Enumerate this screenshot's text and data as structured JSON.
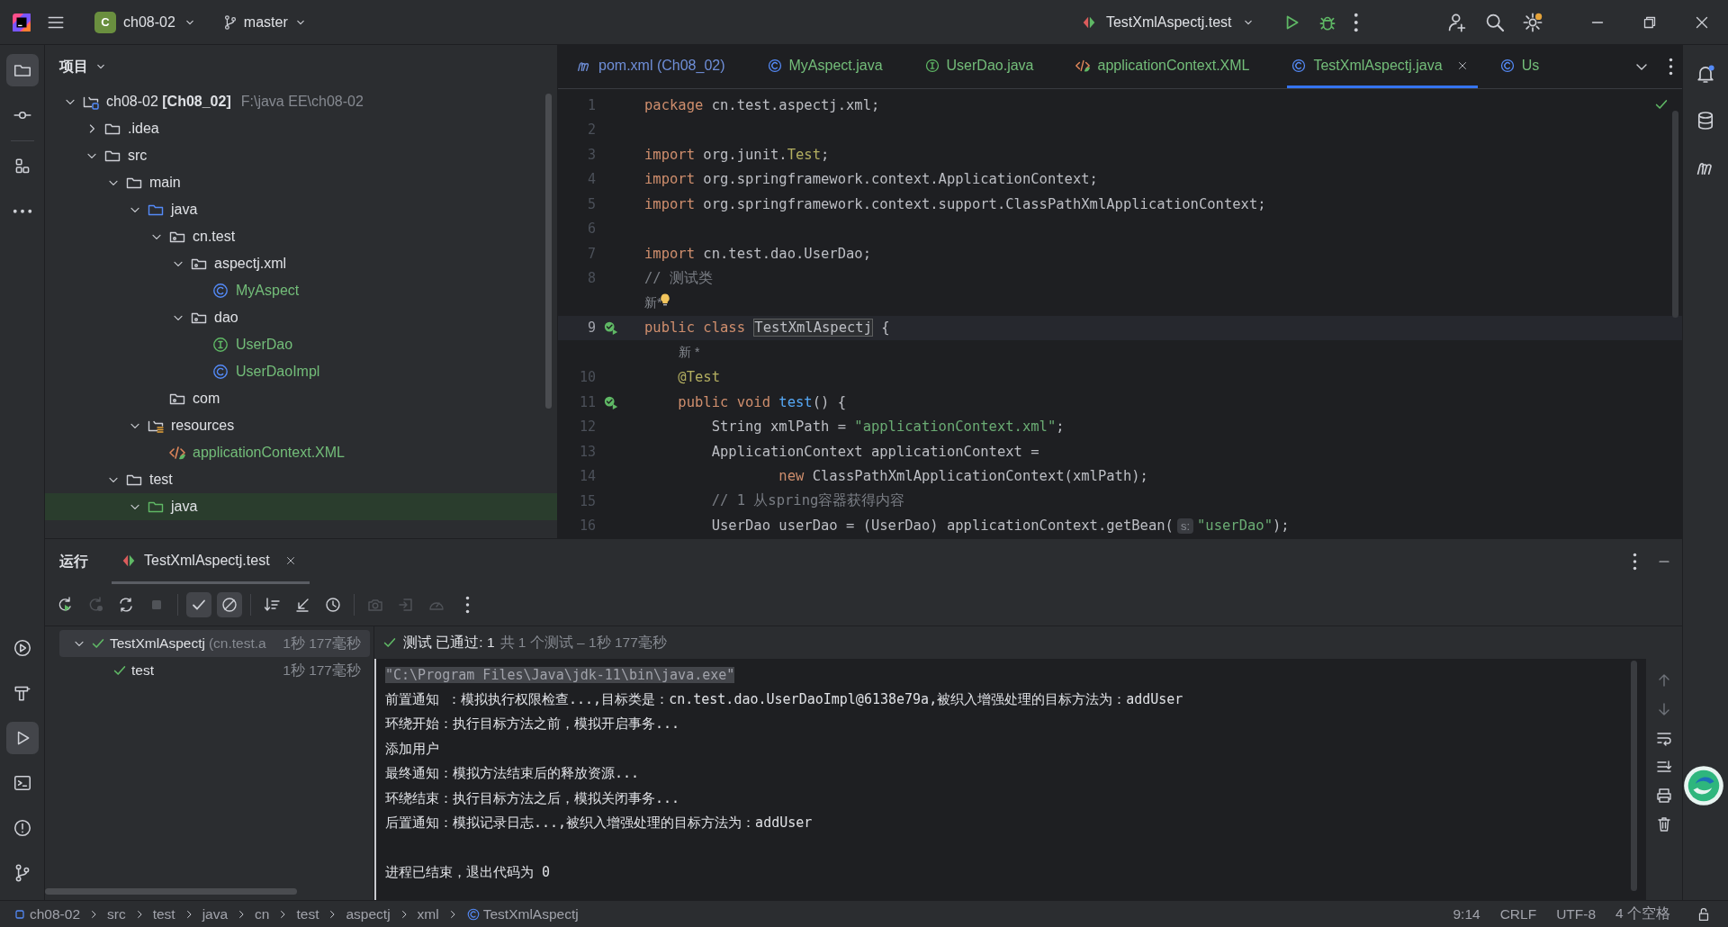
{
  "title_bar": {
    "project_badge": "C",
    "project": "ch08-02",
    "branch": "master",
    "run_config": "TestXmlAspectj.test"
  },
  "left_strip": {
    "top": [
      {
        "kind": "folder",
        "selected": true
      },
      {
        "kind": "commit",
        "selected": false
      },
      {
        "kind": "structure",
        "selected": false
      },
      {
        "kind": "more",
        "selected": false
      }
    ],
    "bottom": [
      {
        "kind": "services",
        "selected": false
      },
      {
        "kind": "build",
        "selected": false
      },
      {
        "kind": "run",
        "selected": true
      },
      {
        "kind": "terminal",
        "selected": false
      },
      {
        "kind": "problems",
        "selected": false
      },
      {
        "kind": "git",
        "selected": false
      }
    ]
  },
  "right_strip": [
    {
      "kind": "bell"
    },
    {
      "kind": "database"
    },
    {
      "kind": "maven"
    }
  ],
  "project_panel": {
    "title": "项目",
    "tree": [
      {
        "label": "ch08-02 **[Ch08_02]**",
        "path": "F:\\java EE\\ch08-02",
        "kind": "module",
        "expanded": true,
        "selected": false,
        "children": [
          {
            "label": ".idea",
            "kind": "folder",
            "expanded": false,
            "selected": false
          },
          {
            "label": "src",
            "kind": "folder",
            "expanded": true,
            "selected": false,
            "children": [
              {
                "label": "main",
                "kind": "folder",
                "expanded": true,
                "selected": false,
                "children": [
                  {
                    "label": "java",
                    "kind": "source",
                    "expanded": true,
                    "selected": false,
                    "children": [
                      {
                        "label": "cn.test",
                        "kind": "package",
                        "expanded": true,
                        "selected": false,
                        "children": [
                          {
                            "label": "aspectj.xml",
                            "kind": "package",
                            "expanded": true,
                            "selected": false,
                            "children": [
                              {
                                "label": "MyAspect",
                                "kind": "class",
                                "color": "#73bd79",
                                "selected": false
                              }
                            ]
                          },
                          {
                            "label": "dao",
                            "kind": "package",
                            "expanded": true,
                            "selected": false,
                            "children": [
                              {
                                "label": "UserDao",
                                "kind": "interface",
                                "color": "#73bd79",
                                "selected": false
                              },
                              {
                                "label": "UserDaoImpl",
                                "kind": "class",
                                "color": "#73bd79",
                                "selected": false
                              }
                            ]
                          }
                        ]
                      },
                      {
                        "label": "com",
                        "kind": "package",
                        "selected": false
                      }
                    ]
                  },
                  {
                    "label": "resources",
                    "kind": "resources",
                    "expanded": true,
                    "selected": false,
                    "children": [
                      {
                        "label": "applicationContext.XML",
                        "kind": "xml",
                        "color": "#73bd79",
                        "selected": false
                      }
                    ]
                  }
                ]
              },
              {
                "label": "test",
                "kind": "folder",
                "expanded": true,
                "selected": false,
                "children": [
                  {
                    "label": "java",
                    "kind": "testsource",
                    "expanded": true,
                    "selected": true
                  }
                ]
              }
            ]
          }
        ]
      }
    ]
  },
  "editor_tabs": [
    {
      "label": "pom.xml (Ch08_02)",
      "kind": "maven",
      "color": "#6f8fd9",
      "selected": false,
      "closable": false
    },
    {
      "label": "MyAspect.java",
      "kind": "class",
      "color": "#73bd79",
      "selected": false,
      "closable": false
    },
    {
      "label": "UserDao.java",
      "kind": "interface",
      "color": "#73bd79",
      "selected": false,
      "closable": false
    },
    {
      "label": "applicationContext.XML",
      "kind": "xml",
      "color": "#73bd79",
      "selected": false,
      "closable": false
    },
    {
      "label": "TestXmlAspectj.java",
      "kind": "class",
      "color": "#73bd79",
      "selected": true,
      "closable": true
    },
    {
      "label": "Us",
      "kind": "class",
      "color": "#73bd79",
      "selected": false,
      "closable": false
    }
  ],
  "editor": {
    "lines": [
      {
        "kind": "code",
        "number": "1",
        "current": false,
        "run_marker": false,
        "tokens": [
          {
            "kind": "kw",
            "text": "package"
          },
          {
            "kind": "plain",
            "text": " cn.test.aspectj.xml;"
          }
        ]
      },
      {
        "kind": "code",
        "number": "2",
        "current": false,
        "run_marker": false
      },
      {
        "kind": "code",
        "number": "3",
        "current": false,
        "run_marker": false,
        "tokens": [
          {
            "kind": "kw",
            "text": "import"
          },
          {
            "kind": "plain",
            "text": " org.junit."
          },
          {
            "kind": "ann",
            "text": "Test"
          },
          {
            "kind": "plain",
            "text": ";"
          }
        ]
      },
      {
        "kind": "code",
        "number": "4",
        "current": false,
        "run_marker": false,
        "tokens": [
          {
            "kind": "kw",
            "text": "import"
          },
          {
            "kind": "plain",
            "text": " org.springframework.context.ApplicationContext;"
          }
        ]
      },
      {
        "kind": "code",
        "number": "5",
        "current": false,
        "run_marker": false,
        "tokens": [
          {
            "kind": "kw",
            "text": "import"
          },
          {
            "kind": "plain",
            "text": " org.springframework.context.support.ClassPathXmlApplicationContext;"
          }
        ]
      },
      {
        "kind": "code",
        "number": "6",
        "current": false,
        "run_marker": false
      },
      {
        "kind": "code",
        "number": "7",
        "current": false,
        "run_marker": false,
        "tokens": [
          {
            "kind": "kw",
            "text": "import"
          },
          {
            "kind": "plain",
            "text": " cn.test.dao.UserDao;"
          }
        ]
      },
      {
        "kind": "code",
        "number": "8",
        "current": false,
        "run_marker": false,
        "tokens": [
          {
            "kind": "cmt",
            "text": "// 测试类"
          }
        ]
      },
      {
        "kind": "hint",
        "text": "新*",
        "bulb": true,
        "indent": false
      },
      {
        "kind": "code",
        "number": "9",
        "current": true,
        "run_marker": true,
        "tokens": [
          {
            "kind": "kw",
            "text": "public class "
          },
          {
            "kind": "ident",
            "text": "TestXmlAspectj"
          },
          {
            "kind": "plain",
            "text": " {"
          }
        ]
      },
      {
        "kind": "hint",
        "text": "新 *",
        "bulb": false,
        "indent": true
      },
      {
        "kind": "code",
        "number": "10",
        "current": false,
        "run_marker": false,
        "tokens": [
          {
            "kind": "ann",
            "text": "    @Test"
          }
        ]
      },
      {
        "kind": "code",
        "number": "11",
        "current": false,
        "run_marker": true,
        "tokens": [
          {
            "kind": "kw",
            "text": "    public void "
          },
          {
            "kind": "fn",
            "text": "test"
          },
          {
            "kind": "plain",
            "text": "() {"
          }
        ]
      },
      {
        "kind": "code",
        "number": "12",
        "current": false,
        "run_marker": false,
        "tokens": [
          {
            "kind": "plain",
            "text": "        String xmlPath = "
          },
          {
            "kind": "str",
            "text": "\"applicationContext.xml\""
          },
          {
            "kind": "plain",
            "text": ";"
          }
        ]
      },
      {
        "kind": "code",
        "number": "13",
        "current": false,
        "run_marker": false,
        "tokens": [
          {
            "kind": "plain",
            "text": "        ApplicationContext applicationContext ="
          }
        ]
      },
      {
        "kind": "code",
        "number": "14",
        "current": false,
        "run_marker": false,
        "tokens": [
          {
            "kind": "kw",
            "text": "                new"
          },
          {
            "kind": "plain",
            "text": " ClassPathXmlApplicationContext(xmlPath);"
          }
        ]
      },
      {
        "kind": "code",
        "number": "15",
        "current": false,
        "run_marker": false,
        "tokens": [
          {
            "kind": "cmt",
            "text": "        // 1 从spring容器获得内容"
          }
        ]
      },
      {
        "kind": "code",
        "number": "16",
        "current": false,
        "run_marker": false,
        "tokens": [
          {
            "kind": "plain",
            "text": "        UserDao userDao = (UserDao) applicationContext.getBean("
          },
          {
            "kind": "param",
            "text": "s:"
          },
          {
            "kind": "str",
            "text": "\"userDao\""
          },
          {
            "kind": "plain",
            "text": ");"
          }
        ]
      }
    ]
  },
  "run_panel": {
    "title": "运行",
    "tabs": [
      {
        "label": "TestXmlAspectj.test",
        "selected": true
      }
    ],
    "toolbar": [
      {
        "kind": "rerun",
        "toggled": false,
        "disabled": false
      },
      {
        "kind": "rerun-failed",
        "toggled": false,
        "disabled": true
      },
      {
        "kind": "auto-rerun",
        "toggled": false,
        "disabled": false
      },
      {
        "kind": "stop",
        "toggled": false,
        "disabled": true
      },
      {
        "kind": "sep"
      },
      {
        "kind": "check",
        "toggled": true,
        "disabled": false
      },
      {
        "kind": "ignored",
        "toggled": true,
        "disabled": false
      },
      {
        "kind": "sep"
      },
      {
        "kind": "sort",
        "toggled": false,
        "disabled": false
      },
      {
        "kind": "collapse",
        "toggled": false,
        "disabled": false
      },
      {
        "kind": "history",
        "toggled": false,
        "disabled": false
      },
      {
        "kind": "sep"
      },
      {
        "kind": "camera",
        "toggled": false,
        "disabled": true
      },
      {
        "kind": "import",
        "toggled": false,
        "disabled": true
      },
      {
        "kind": "gauge",
        "toggled": false,
        "disabled": true
      },
      {
        "kind": "more",
        "toggled": false,
        "disabled": false
      }
    ],
    "tests": [
      {
        "name": "TestXmlAspectj",
        "package": "(cn.test.a",
        "time": "1秒 177毫秒",
        "passed": true,
        "expanded": true,
        "selected": true,
        "children": [
          {
            "name": "test",
            "time": "1秒 177毫秒",
            "passed": true,
            "selected": false
          }
        ]
      }
    ],
    "summary": {
      "status": "测试 已通过: 1",
      "detail": "共 1 个测试 – 1秒 177毫秒",
      "passed": true
    },
    "console": [
      {
        "kind": "command",
        "text": "\"C:\\Program Files\\Java\\jdk-11\\bin\\java.exe\""
      },
      {
        "kind": "output",
        "text": "前置通知 ：模拟执行权限检查...,目标类是：cn.test.dao.UserDaoImpl@6138e79a,被织入增强处理的目标方法为：addUser"
      },
      {
        "kind": "output",
        "text": "环绕开始：执行目标方法之前，模拟开启事务..."
      },
      {
        "kind": "output",
        "text": "添加用户"
      },
      {
        "kind": "output",
        "text": "最终通知：模拟方法结束后的释放资源..."
      },
      {
        "kind": "output",
        "text": "环绕结束：执行目标方法之后，模拟关闭事务..."
      },
      {
        "kind": "output",
        "text": "后置通知：模拟记录日志...,被织入增强处理的目标方法为：addUser"
      },
      {
        "kind": "blank"
      },
      {
        "kind": "exit",
        "text": "进程已结束，退出代码为 0"
      }
    ],
    "console_tools": [
      {
        "kind": "up"
      },
      {
        "kind": "down"
      },
      {
        "kind": "wrap"
      },
      {
        "kind": "scroll-end"
      },
      {
        "kind": "print"
      },
      {
        "kind": "trash"
      }
    ]
  },
  "status_bar": {
    "breadcrumbs": [
      {
        "label": "ch08-02",
        "kind": "module"
      },
      {
        "label": "src",
        "kind": "plain"
      },
      {
        "label": "test",
        "kind": "plain"
      },
      {
        "label": "java",
        "kind": "plain"
      },
      {
        "label": "cn",
        "kind": "plain"
      },
      {
        "label": "test",
        "kind": "plain"
      },
      {
        "label": "aspectj",
        "kind": "plain"
      },
      {
        "label": "xml",
        "kind": "plain"
      },
      {
        "label": "TestXmlAspectj",
        "kind": "class"
      }
    ],
    "items": [
      "9:14",
      "CRLF",
      "UTF-8",
      "4 个空格"
    ]
  }
}
